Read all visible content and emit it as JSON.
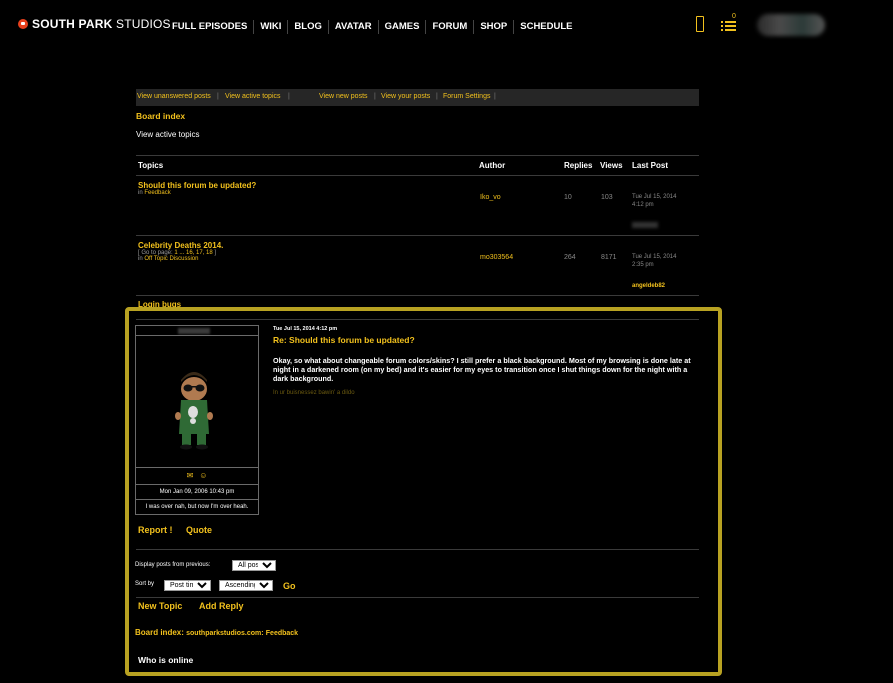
{
  "brand": {
    "name_bold": "SOUTH PARK",
    "name_light": " STUDIOS"
  },
  "nav": [
    "FULL EPISODES",
    "WIKI",
    "BLOG",
    "AVATAR",
    "GAMES",
    "FORUM",
    "SHOP",
    "SCHEDULE"
  ],
  "header_badge": "0",
  "linkbar": {
    "unanswered": "View unanswered posts",
    "active": "View active topics",
    "new": "View new posts",
    "yours": "View your posts",
    "settings": "Forum Settings",
    "sep": "|"
  },
  "breadcrumb_top": "Board index",
  "page_heading": "View active topics",
  "topics_table": {
    "headers": {
      "topics": "Topics",
      "author": "Author",
      "replies": "Replies",
      "views": "Views",
      "last_post": "Last Post"
    },
    "rows": [
      {
        "title": "Should this forum be updated?",
        "in_prefix": "in ",
        "forum": "Feedback",
        "author": "Iko_vo",
        "replies": "10",
        "views": "103",
        "last_date": "Tue Jul 15, 2014",
        "last_time": "4:12 pm",
        "last_author": ""
      },
      {
        "title": "Celebrity Deaths 2014.",
        "pages_prefix": "[ Go to page: ",
        "pages": "1 ... 16, 17, 18",
        "pages_suffix": " ]",
        "in_prefix": "in ",
        "forum": "Off Topic Discussion",
        "author": "mo303564",
        "replies": "264",
        "views": "8171",
        "last_date": "Tue Jul 15, 2014",
        "last_time": "2:35 pm",
        "last_author": "angeldeb82"
      }
    ],
    "partial_row_title": "Login bugs"
  },
  "post": {
    "timestamp": "Tue Jul 15, 2014 4:12 pm",
    "title": "Re: Should this forum be updated?",
    "body": "Okay, so what about changeable forum colors/skins? I still prefer a black background. Most of my browsing is done late at night in a darkened room (on my bed) and it's easier for my eyes to transition once I shut things down for the night with a dark background.",
    "signature": "In ur buisnessez bawin' a dildo",
    "joined": "Mon Jan 09, 2006 10:43 pm",
    "location": "I was over nah, but now I'm over heah.",
    "report_label": "Report",
    "report_mark": "!",
    "quote_label": "Quote"
  },
  "options": {
    "display_label": "Display posts from previous:",
    "display_value": "All posts",
    "sort_label": "Sort by",
    "sort_value": "Post time",
    "order_value": "Ascending",
    "go_label": "Go"
  },
  "actions": {
    "new_topic": "New Topic",
    "add_reply": "Add Reply"
  },
  "breadcrumb_bottom": {
    "label": "Board index:",
    "site": "southparkstudios.com:",
    "forum": "Feedback"
  },
  "who_is_online": "Who is online",
  "colors": {
    "accent": "#f2c11d",
    "highlight_border": "#b8a222",
    "logo": "#e8401c",
    "background": "#000000"
  }
}
